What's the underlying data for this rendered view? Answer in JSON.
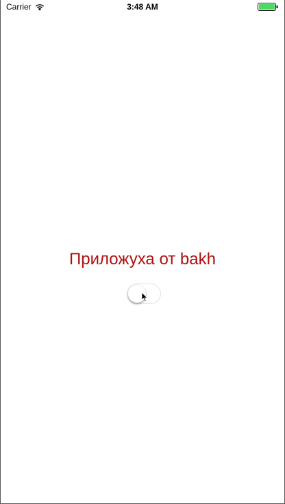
{
  "status_bar": {
    "carrier": "Carrier",
    "time": "3:48 AM",
    "wifi_icon": "wifi-icon",
    "battery_icon": "battery-icon",
    "battery_color": "#4cd964"
  },
  "main": {
    "title": "Приложуха от bakh",
    "title_color": "#b00f0f",
    "toggle": {
      "state": "off"
    }
  }
}
